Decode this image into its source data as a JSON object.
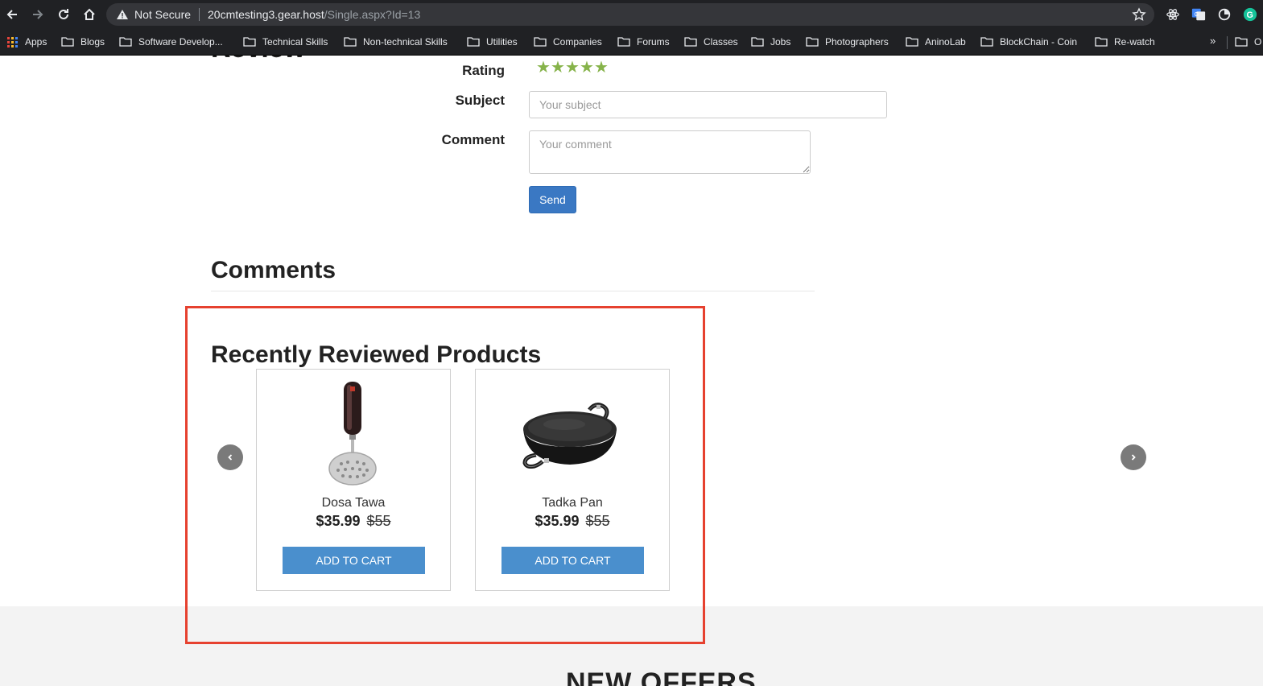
{
  "browser": {
    "security_label": "Not Secure",
    "url_host": "20cmtesting3.gear.host",
    "url_path": "/Single.aspx?Id=13",
    "bookmarks": {
      "apps_label": "Apps",
      "items": [
        {
          "label": "Blogs"
        },
        {
          "label": "Software Develop..."
        },
        {
          "label": "Technical Skills"
        },
        {
          "label": "Non-technical Skills"
        },
        {
          "label": "Utilities"
        },
        {
          "label": "Companies"
        },
        {
          "label": "Forums"
        },
        {
          "label": "Classes"
        },
        {
          "label": "Jobs"
        },
        {
          "label": "Photographers"
        },
        {
          "label": "AninoLab"
        },
        {
          "label": "BlockChain - Coin"
        },
        {
          "label": "Re-watch"
        }
      ],
      "overflow_label": "»",
      "overflow_item_label": "O"
    }
  },
  "review_form": {
    "heading_partial": "Review",
    "rating_label": "Rating",
    "rating_value": 5,
    "star_glyph": "★",
    "star_color": "#86b34a",
    "subject_label": "Subject",
    "subject_placeholder": "Your subject",
    "comment_label": "Comment",
    "comment_placeholder": "Your comment",
    "send_label": "Send"
  },
  "comments": {
    "title": "Comments"
  },
  "recently_reviewed": {
    "title": "Recently Reviewed Products",
    "products": [
      {
        "name": "Dosa Tawa",
        "price": "$35.99",
        "old_price": "$55",
        "button_label": "ADD TO CART",
        "image": "masher-icon"
      },
      {
        "name": "Tadka Pan",
        "price": "$35.99",
        "old_price": "$55",
        "button_label": "ADD TO CART",
        "image": "kadai-pan-icon"
      }
    ],
    "prev_icon": "chevron-left-icon",
    "next_icon": "chevron-right-icon"
  },
  "new_offers": {
    "title": "NEW OFFERS"
  },
  "colors": {
    "highlight_border": "#e6412f",
    "send_button": "#3a78c3",
    "add_to_cart_button": "#4a8fcd"
  }
}
